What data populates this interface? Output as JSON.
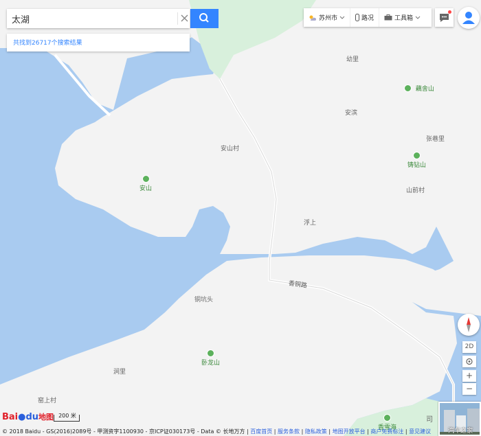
{
  "search": {
    "query": "太湖",
    "result_text": "共找到26717个搜索结果"
  },
  "toolbar": {
    "city": "苏州市",
    "traffic": "路况",
    "toolbox": "工具箱"
  },
  "map": {
    "place_labels": [
      {
        "text": "幼里"
      },
      {
        "text": "安滨"
      },
      {
        "text": "张巷里"
      },
      {
        "text": "安山村"
      },
      {
        "text": "山前村"
      },
      {
        "text": "浮上"
      },
      {
        "text": "铜坑头"
      },
      {
        "text": "涧里"
      },
      {
        "text": "窑上村"
      },
      {
        "text": "司"
      }
    ],
    "pois": [
      {
        "text": "藕舍山"
      },
      {
        "text": "铸钻山"
      },
      {
        "text": "安山"
      },
      {
        "text": "卧龙山"
      },
      {
        "text": "香雪海"
      }
    ],
    "road_label": "香铜路"
  },
  "controls": {
    "view_2d": "2D",
    "zoom_in": "+",
    "zoom_out": "−"
  },
  "footer": {
    "logo_bai": "Bai",
    "logo_du": "du",
    "logo_ditu": "地图",
    "scale": "200 米",
    "copyright": "© 2018 Baidu - GS(2016)2089号 - 甲测资字1100930 - 京ICP证030173号 - Data © 长地万方 |",
    "links": [
      "百度首页",
      "服务条款",
      "隐私政策",
      "地图开放平台",
      "商户免费标注",
      "意见建议"
    ],
    "watermark": "汽车之家"
  },
  "colors": {
    "water": "#a9cbf0",
    "land": "#f3f3f3",
    "park": "#d8f0dc",
    "accent": "#3385ff"
  }
}
